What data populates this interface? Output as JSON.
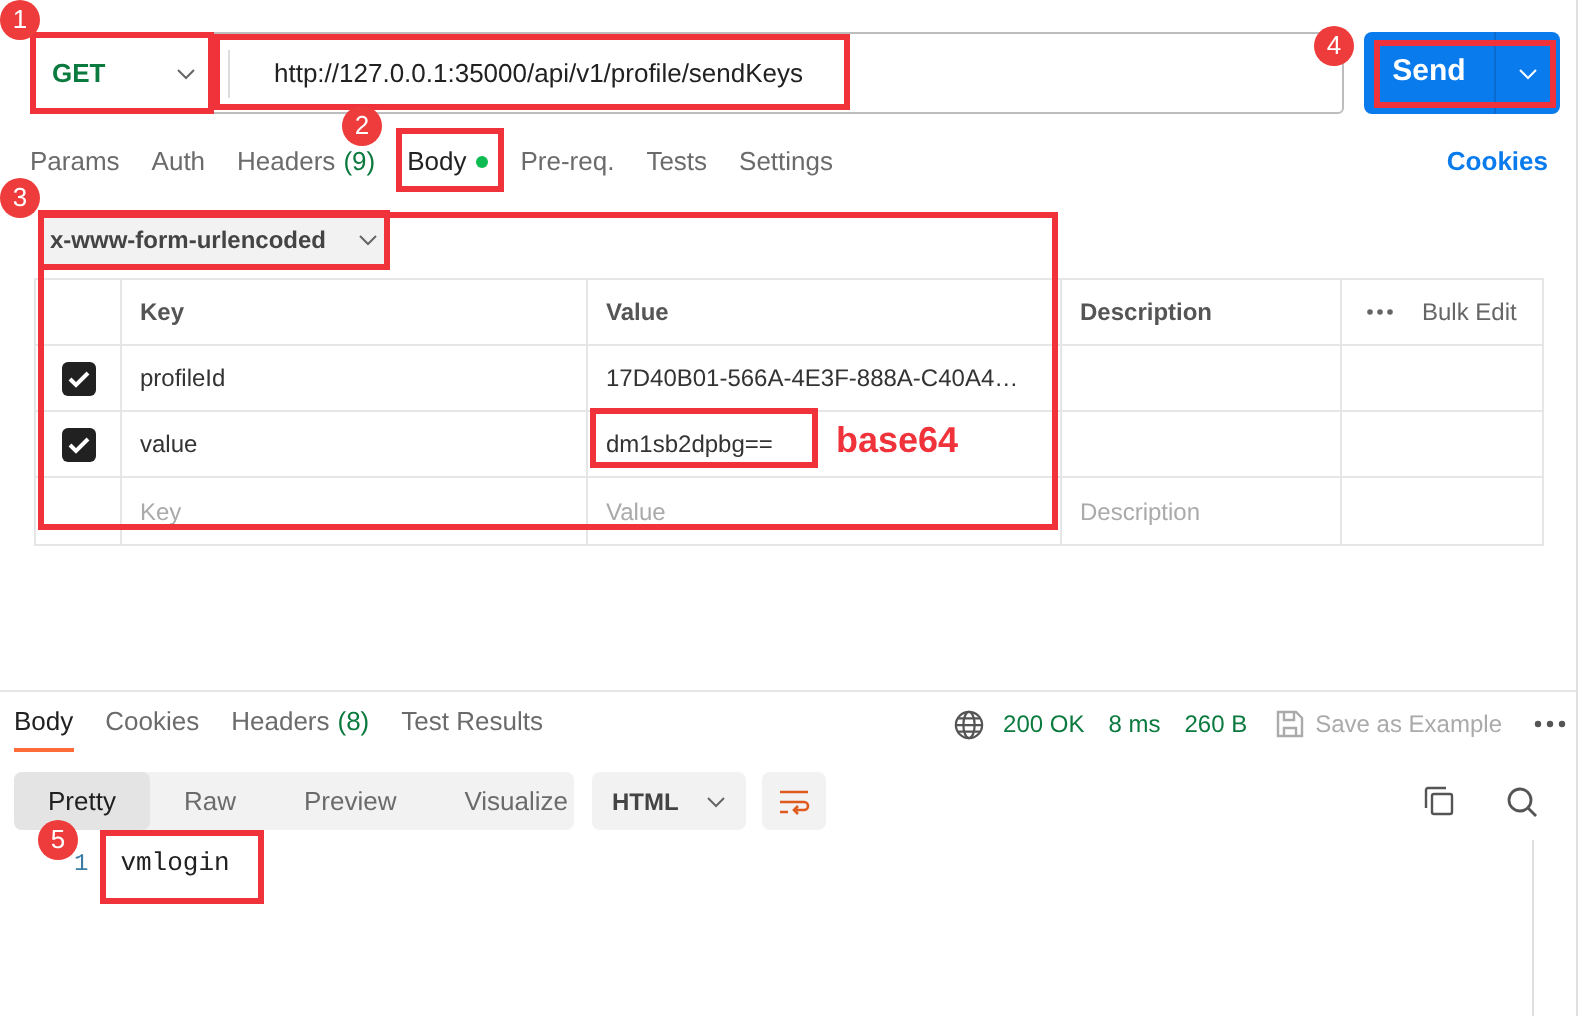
{
  "request": {
    "method": "GET",
    "url": "http://127.0.0.1:35000/api/v1/profile/sendKeys",
    "send": "Send"
  },
  "tabs": [
    {
      "label": "Params",
      "selected": false
    },
    {
      "label": "Auth",
      "selected": false
    },
    {
      "label": "Headers",
      "count": "(9)",
      "selected": false
    },
    {
      "label": "Body",
      "selected": true,
      "dot": true
    },
    {
      "label": "Pre-req.",
      "selected": false
    },
    {
      "label": "Tests",
      "selected": false
    },
    {
      "label": "Settings",
      "selected": false
    }
  ],
  "cookies_link": "Cookies",
  "body_type": "x-www-form-urlencoded",
  "table": {
    "columns": [
      "Key",
      "Value",
      "Description"
    ],
    "bulk_edit": "Bulk Edit",
    "rows": [
      {
        "checked": true,
        "key": "profileId",
        "value": "17D40B01-566A-4E3F-888A-C40A4…"
      },
      {
        "checked": true,
        "key": "value",
        "value": "dm1sb2dpbg=="
      }
    ],
    "new_row": {
      "key": "Key",
      "value": "Value",
      "description": "Description"
    }
  },
  "response": {
    "tabs": [
      {
        "label": "Body",
        "selected": true
      },
      {
        "label": "Cookies",
        "selected": false
      },
      {
        "label": "Headers",
        "count": "(8)",
        "selected": false
      },
      {
        "label": "Test Results",
        "selected": false
      }
    ],
    "status": "200 OK",
    "time": "8 ms",
    "size": "260 B",
    "save": "Save as Example",
    "views": [
      {
        "label": "Pretty",
        "selected": true
      },
      {
        "label": "Raw",
        "selected": false
      },
      {
        "label": "Preview",
        "selected": false
      },
      {
        "label": "Visualize",
        "selected": false
      }
    ],
    "format": "HTML",
    "lines": [
      {
        "number": "1",
        "text": "vmlogin"
      }
    ]
  },
  "annotations": [
    {
      "label": "1"
    },
    {
      "label": "2"
    },
    {
      "label": "3"
    },
    {
      "label": "4"
    },
    {
      "label": "5"
    }
  ],
  "callout": "base64"
}
